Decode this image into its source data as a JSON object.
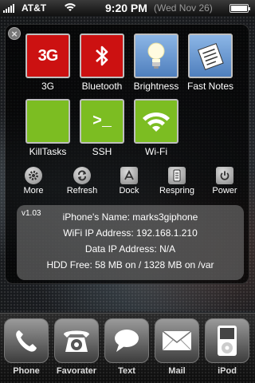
{
  "status_bar": {
    "carrier": "AT&T",
    "time": "9:20 PM",
    "date": "(Wed Nov 26)",
    "battery_level": 1.0
  },
  "panel": {
    "close_label": "×",
    "toggles": [
      {
        "label": "3G",
        "icon_text": "3G",
        "icon": "3g-icon",
        "color": "#cc1111"
      },
      {
        "label": "Bluetooth",
        "icon": "bluetooth-icon",
        "color": "#cc1111"
      },
      {
        "label": "Brightness",
        "icon": "lightbulb-icon",
        "color": "#6f9fd8"
      },
      {
        "label": "Fast Notes",
        "icon": "notepad-icon",
        "color": "#6f9fd8"
      },
      {
        "label": "KillTasks",
        "icon": "blank-icon",
        "color": "#7cbd22"
      },
      {
        "label": "SSH",
        "icon_text": ">_",
        "icon": "terminal-icon",
        "color": "#7cbd22"
      },
      {
        "label": "Wi-Fi",
        "icon": "wifi-icon",
        "color": "#7cbd22"
      }
    ],
    "actions": [
      {
        "label": "More",
        "icon": "gear-icon"
      },
      {
        "label": "Refresh",
        "icon": "refresh-icon"
      },
      {
        "label": "Dock",
        "icon": "app-store-icon"
      },
      {
        "label": "Respring",
        "icon": "respring-icon"
      },
      {
        "label": "Power",
        "icon": "power-icon"
      }
    ],
    "info": {
      "version": "v1.03",
      "name": "iPhone's Name: marks3giphone",
      "wifi_ip": "WiFi IP Address: 192.168.1.210",
      "data_ip": "Data IP Address: N/A",
      "hdd": "HDD Free: 58 MB on / 1328 MB on /var"
    }
  },
  "dock": {
    "items": [
      {
        "label": "Phone",
        "icon": "phone-icon"
      },
      {
        "label": "Favorater",
        "icon": "rotary-phone-icon"
      },
      {
        "label": "Text",
        "icon": "speech-bubble-icon"
      },
      {
        "label": "Mail",
        "icon": "envelope-icon"
      },
      {
        "label": "iPod",
        "icon": "ipod-icon"
      }
    ]
  }
}
